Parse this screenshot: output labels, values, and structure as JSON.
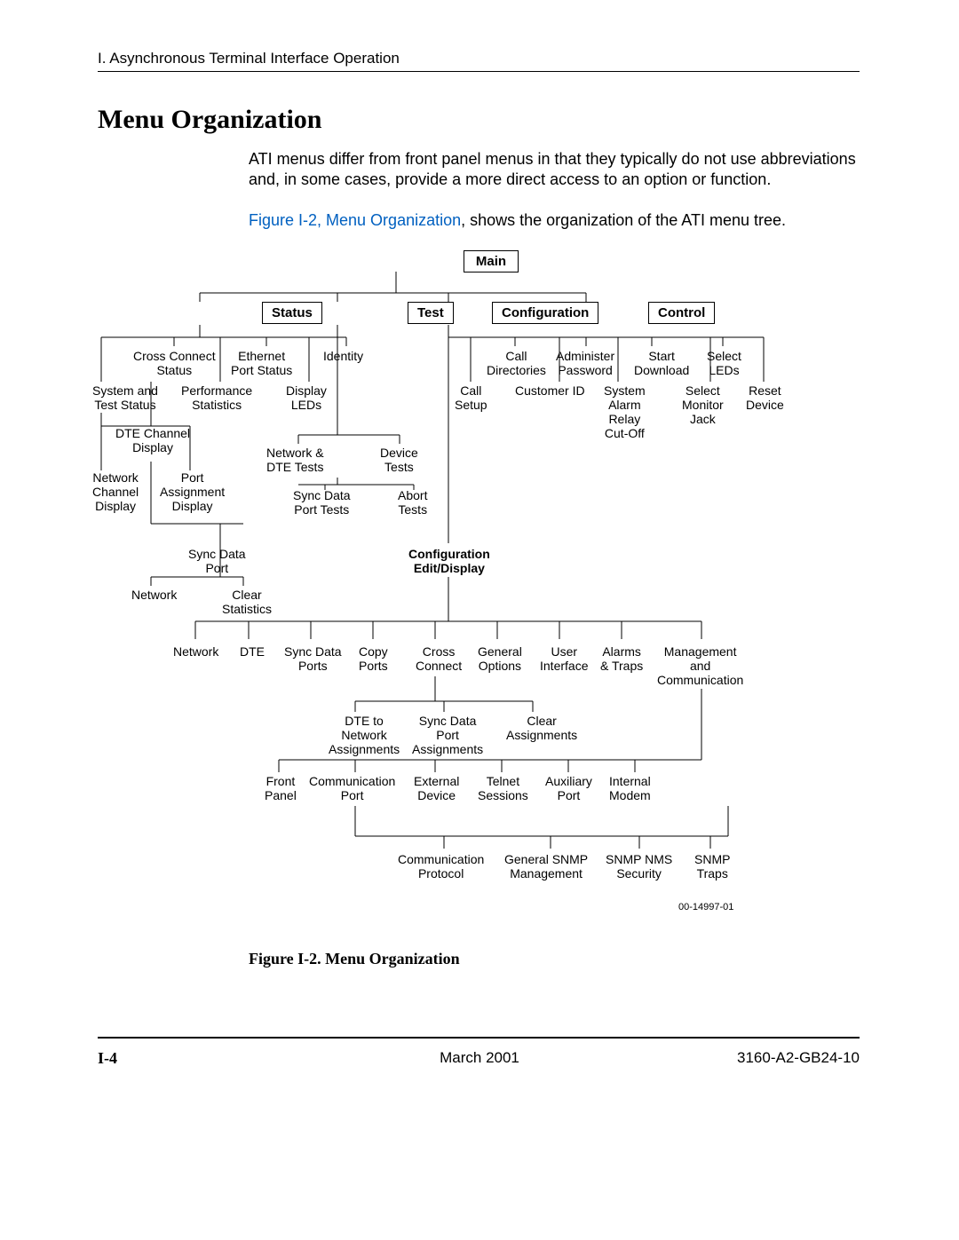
{
  "header": "I. Asynchronous Terminal Interface Operation",
  "title": "Menu Organization",
  "para1": "ATI menus differ from front panel menus in that they typically do not use abbreviations and, in some cases, provide a more direct access to an option or function.",
  "para2_link": "Figure I-2, Menu Organization",
  "para2_rest": ", shows the organization of the ATI menu tree.",
  "caption": "Figure I-2.    Menu Organization",
  "page_num": "I-4",
  "foot_center": "March 2001",
  "foot_right": "3160-A2-GB24-10",
  "diagram_id": "00-14997-01",
  "chart_data": {
    "type": "tree",
    "root": {
      "label": "Main",
      "children": [
        {
          "label": "Status",
          "children": [
            "Cross Connect Status",
            "Ethernet Port Status",
            "Identity",
            "System and Test Status",
            "Performance Statistics",
            "Display LEDs",
            "DTE Channel Display",
            "Network Channel Display",
            "Port Assignment Display",
            {
              "label": "Sync Data Port",
              "children": [
                "Network",
                "Clear Statistics"
              ]
            }
          ]
        },
        {
          "label": "Test",
          "children": [
            "Network & DTE Tests",
            "Device Tests",
            "Sync Data Port Tests",
            "Abort Tests"
          ]
        },
        {
          "label": "Configuration",
          "children": [
            "Call Directories",
            "Administer Password",
            "Start Download",
            "Select LEDs",
            "Call Setup",
            "Customer ID",
            "System Alarm Relay Cut-Off",
            "Select Monitor Jack",
            "Reset Device",
            {
              "label": "Configuration Edit/Display",
              "children": [
                "Network",
                "DTE",
                "Sync Data Ports",
                "Copy Ports",
                {
                  "label": "Cross Connect",
                  "children": [
                    "DTE to Network Assignments",
                    "Sync Data Port Assignments",
                    "Clear Assignments"
                  ]
                },
                "General Options",
                "User Interface",
                "Alarms & Traps",
                {
                  "label": "Management and Communication",
                  "children": [
                    "Front Panel",
                    {
                      "label": "Communication Port",
                      "children": [
                        "Communication Protocol",
                        "General SNMP Management",
                        "SNMP NMS Security",
                        "SNMP Traps"
                      ]
                    },
                    "External Device",
                    "Telnet Sessions",
                    "Auxiliary Port",
                    "Internal Modem"
                  ]
                }
              ]
            }
          ]
        },
        {
          "label": "Control"
        }
      ]
    }
  },
  "boxes": {
    "main": "Main",
    "status": "Status",
    "test": "Test",
    "configuration": "Configuration",
    "control": "Control"
  },
  "labels": {
    "cross_connect_status": "Cross Connect\nStatus",
    "ethernet_port_status": "Ethernet\nPort Status",
    "identity": "Identity",
    "system_test_status": "System and\nTest Status",
    "performance_stats": "Performance\nStatistics",
    "display_leds": "Display\nLEDs",
    "dte_channel_display": "DTE Channel\nDisplay",
    "network_channel_display": "Network\nChannel\nDisplay",
    "port_assignment_display": "Port\nAssignment\nDisplay",
    "network_dte_tests": "Network &\nDTE Tests",
    "device_tests": "Device\nTests",
    "sync_data_port_tests": "Sync Data\nPort Tests",
    "abort_tests": "Abort\nTests",
    "sync_data_port": "Sync Data\nPort",
    "network_leaf": "Network",
    "clear_stats": "Clear\nStatistics",
    "call_directories": "Call\nDirectories",
    "administer_password": "Administer\nPassword",
    "start_download": "Start\nDownload",
    "select_leds": "Select\nLEDs",
    "call_setup": "Call\nSetup",
    "customer_id": "Customer ID",
    "system_alarm": "System\nAlarm\nRelay\nCut-Off",
    "select_monitor_jack": "Select\nMonitor\nJack",
    "reset_device": "Reset\nDevice",
    "config_edit_display": "Configuration\nEdit/Display",
    "cfg_network": "Network",
    "cfg_dte": "DTE",
    "cfg_sync_data_ports": "Sync Data\nPorts",
    "cfg_copy_ports": "Copy\nPorts",
    "cfg_cross_connect": "Cross\nConnect",
    "cfg_general_options": "General\nOptions",
    "cfg_user_interface": "User\nInterface",
    "cfg_alarms_traps": "Alarms\n& Traps",
    "cfg_mgmt_comm": "Management\nand\nCommunication",
    "cc_dte_net": "DTE to\nNetwork\nAssignments",
    "cc_sync_port": "Sync Data\nPort\nAssignments",
    "cc_clear": "Clear\nAssignments",
    "mc_front_panel": "Front\nPanel",
    "mc_comm_port": "Communication\nPort",
    "mc_external_device": "External\nDevice",
    "mc_telnet": "Telnet\nSessions",
    "mc_aux_port": "Auxiliary\nPort",
    "mc_internal_modem": "Internal\nModem",
    "cp_protocol": "Communication\nProtocol",
    "cp_snmp_mgmt": "General SNMP\nManagement",
    "cp_snmp_sec": "SNMP NMS\nSecurity",
    "cp_snmp_traps": "SNMP\nTraps"
  }
}
